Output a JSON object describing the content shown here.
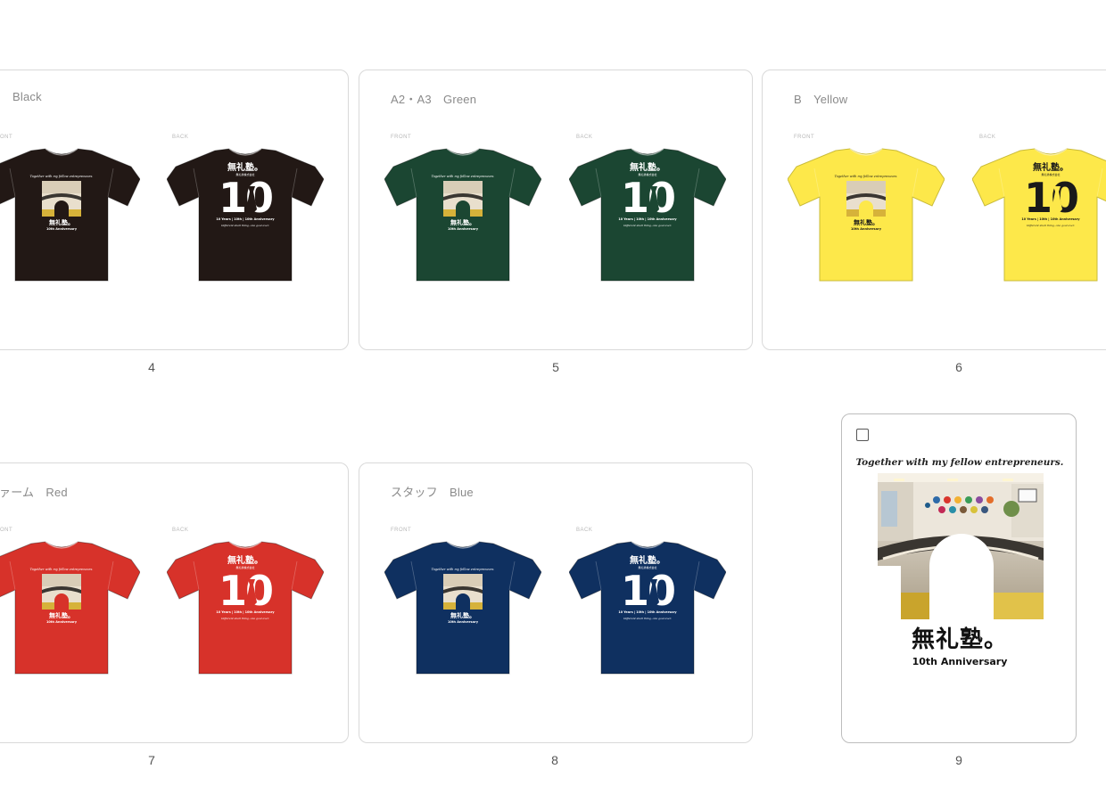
{
  "labels": {
    "front": "FRONT",
    "back": "BACK"
  },
  "shirt_print": {
    "logo": "無礼塾。",
    "sub": "無礼塾株式会社",
    "number": "10",
    "tagline": "Together with my fellow entrepreneurs.",
    "front_anniv": "10th Anniversary",
    "back_line": "10 Years | 10th | 10th Anniversary",
    "back_tagline": "Different shall thing, one goal ever."
  },
  "cards": [
    {
      "title": "Black",
      "color": "#221815",
      "print": "#ffffff",
      "page": "4"
    },
    {
      "title": "A2・A3　Green",
      "color": "#1b4632",
      "print": "#ffffff",
      "page": "5"
    },
    {
      "title": "B　Yellow",
      "color": "#fde84a",
      "print": "#1a1a1a",
      "page": "6"
    },
    {
      "title": "ァーム　Red",
      "color": "#d7322a",
      "print": "#ffffff",
      "page": "7"
    },
    {
      "title": "スタッフ　Blue",
      "color": "#0f3060",
      "print": "#ffffff",
      "page": "8"
    }
  ],
  "poster": {
    "tagline": "Together with my fellow entrepreneurs.",
    "logo": "無礼塾。",
    "anniversary": "10th Anniversary",
    "page": "9"
  }
}
